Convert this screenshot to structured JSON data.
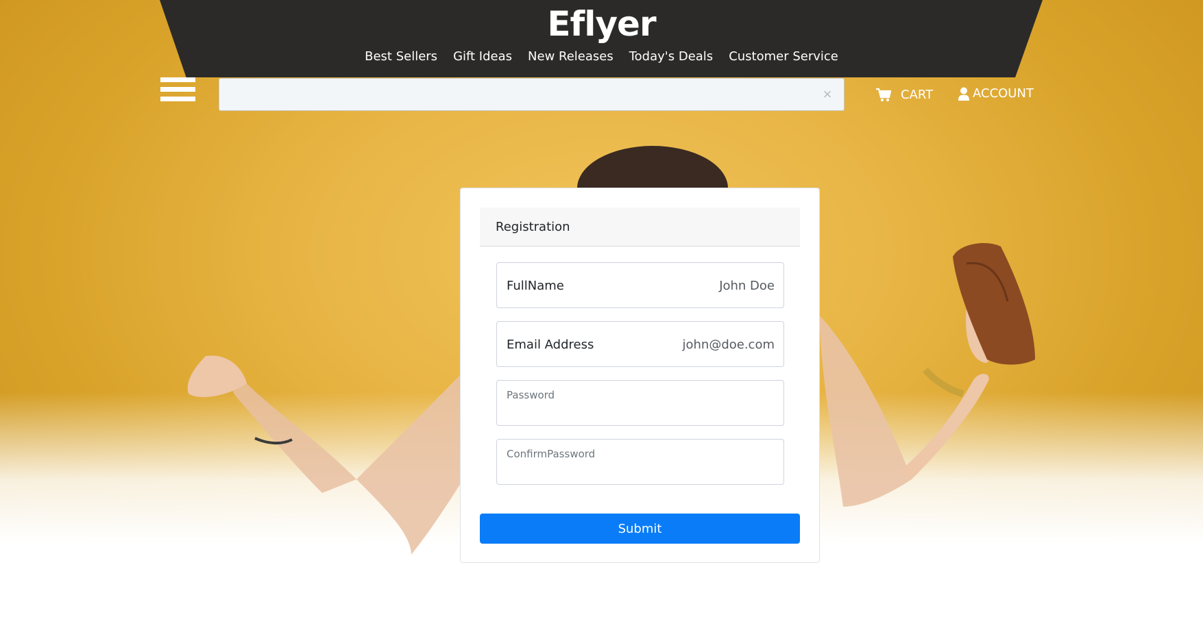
{
  "brand": {
    "logo": "Eflyer"
  },
  "nav": {
    "items": [
      "Best Sellers",
      "Gift Ideas",
      "New Releases",
      "Today's Deals",
      "Customer Service"
    ]
  },
  "search": {
    "value": "",
    "clear_icon": "close-icon"
  },
  "header_actions": {
    "cart_label": "CART",
    "cart_icon": "cart-icon",
    "account_label": "ACCOUNT",
    "account_icon": "user-icon"
  },
  "form": {
    "title": "Registration",
    "fields": [
      {
        "label": "FullName",
        "value": "John Doe"
      },
      {
        "label": "Email Address",
        "value": "john@doe.com"
      },
      {
        "placeholder": "Password"
      },
      {
        "placeholder": "ConfirmPassword"
      }
    ],
    "submit_label": "Submit"
  },
  "colors": {
    "header_bg": "#2b2a29",
    "hero_yellow": "#e8b545",
    "submit_blue": "#0a7cf8"
  }
}
